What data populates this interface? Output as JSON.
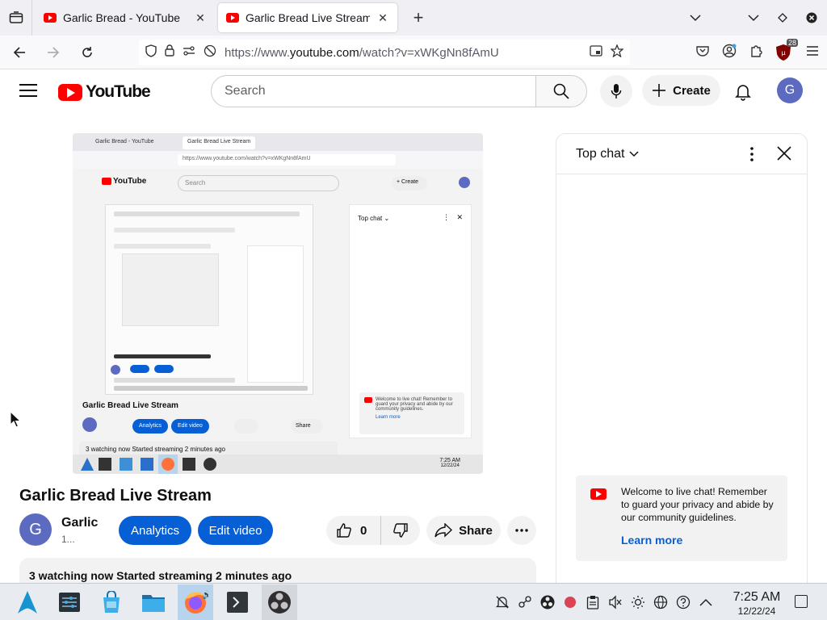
{
  "browser": {
    "tabs": [
      {
        "title": "Garlic Bread - YouTube",
        "active": false
      },
      {
        "title": "Garlic Bread Live Stream - YouTube",
        "active": true
      }
    ],
    "url_prefix": "https://www.",
    "url_host": "youtube.com",
    "url_path": "/watch?v=xWKgNn8fAmU",
    "extension_badge": "28"
  },
  "youtube": {
    "logo_text": "YouTube",
    "search_placeholder": "Search",
    "create_label": "Create",
    "avatar_letter": "G"
  },
  "video": {
    "title": "Garlic Bread Live Stream",
    "channel_name": "Garlic Bread",
    "channel_subs": "1...",
    "channel_avatar": "G",
    "analytics_label": "Analytics",
    "edit_label": "Edit video",
    "like_count": "0",
    "share_label": "Share",
    "description": "3 watching now  Started streaming 2 minutes ago",
    "nested": {
      "tab1": "Garlic Bread - YouTube",
      "tab2": "Garlic Bread Live Stream",
      "url": "https://www.youtube.com/watch?v=xWKgNn8fAmU",
      "search": "Search",
      "create": "Create",
      "top_chat": "Top chat",
      "welcome": "Welcome to live chat! Remember to guard your privacy and abide by our community guidelines.",
      "learn_more": "Learn more",
      "title": "Garlic Bread Live Stream",
      "analytics": "Analytics",
      "edit": "Edit video",
      "share": "Share",
      "info": "3 watching now  Started streaming 2 minutes ago",
      "time": "7:25 AM",
      "date": "12/22/24"
    }
  },
  "chat": {
    "title": "Top chat",
    "welcome_text": "Welcome to live chat! Remember to guard your privacy and abide by our community guidelines.",
    "learn_more": "Learn more"
  },
  "taskbar": {
    "time": "7:25 AM",
    "date": "12/22/24"
  },
  "colors": {
    "youtube_red": "#ff0000",
    "blue_button": "#065fd4",
    "avatar": "#5c6bc0"
  }
}
